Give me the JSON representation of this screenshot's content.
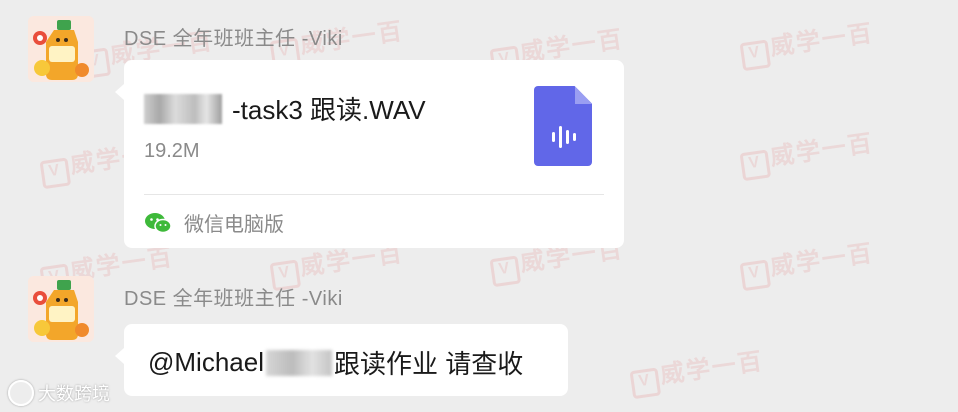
{
  "watermark": {
    "text": "威学一百",
    "badge": "V"
  },
  "messages": [
    {
      "sender": "DSE 全年班班主任 -Viki",
      "avatar_icon": "cartoon-juice-bottle-avatar",
      "file": {
        "name": "-task3 跟读.WAV",
        "size": "19.2M",
        "icon": "audio-file-icon",
        "source_icon": "wechat-icon",
        "source_label": "微信电脑版"
      }
    },
    {
      "sender": "DSE 全年班班主任 -Viki",
      "avatar_icon": "cartoon-juice-bottle-avatar",
      "text": {
        "mention": "@Michael",
        "body": "跟读作业 请查收"
      }
    }
  ],
  "corner_logo": {
    "text": "大数跨境",
    "icon": "brand-logo-icon"
  },
  "colors": {
    "background": "#ededed",
    "bubble": "#ffffff",
    "file_icon": "#6167e8",
    "sender_text": "#8a8a8a",
    "wechat_green": "#3eb93a"
  }
}
